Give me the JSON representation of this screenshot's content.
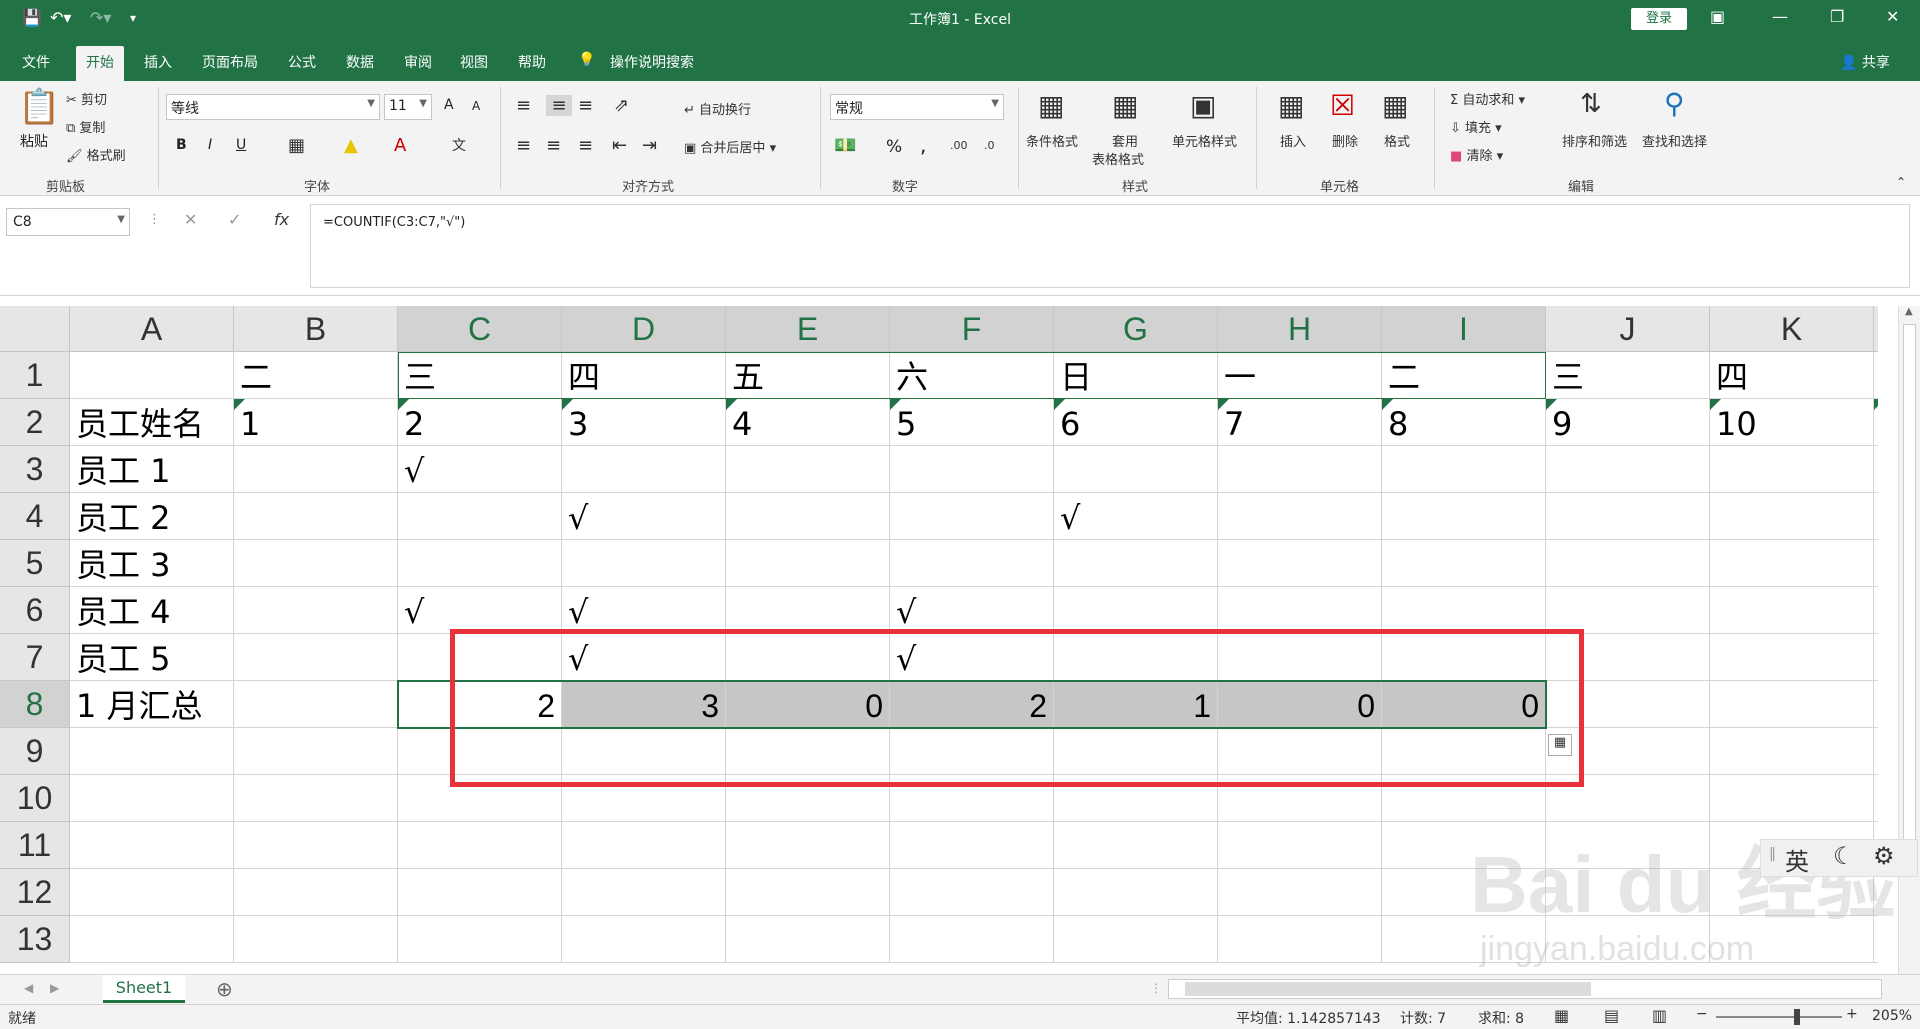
{
  "title": "工作簿1  -  Excel",
  "login": "登录",
  "share": "共享",
  "tabs": [
    "文件",
    "开始",
    "插入",
    "页面布局",
    "公式",
    "数据",
    "审阅",
    "视图",
    "帮助",
    "操作说明搜索"
  ],
  "clipboard": {
    "paste": "粘贴",
    "cut": "剪切",
    "copy": "复制",
    "painter": "格式刷",
    "group": "剪贴板"
  },
  "font": {
    "name": "等线",
    "size": "11",
    "group": "字体",
    "bold": "B",
    "italic": "I",
    "underline": "U",
    "grow": "A",
    "shrink": "A"
  },
  "align": {
    "wrap": "自动换行",
    "merge": "合并后居中",
    "group": "对齐方式"
  },
  "number": {
    "format": "常规",
    "percent": "%",
    "comma": ",",
    "group": "数字"
  },
  "styles": {
    "cond": "条件格式",
    "table1": "套用",
    "table2": "表格格式",
    "cell": "单元格样式",
    "group": "样式"
  },
  "cells": {
    "insert": "插入",
    "delete": "删除",
    "format": "格式",
    "group": "单元格"
  },
  "editing": {
    "autosum": "自动求和",
    "fill": "填充",
    "clear": "清除",
    "sort": "排序和筛选",
    "find": "查找和选择",
    "group": "编辑"
  },
  "namebox": "C8",
  "formula": "=COUNTIF(C3:C7,\"√\")",
  "columns": [
    "A",
    "B",
    "C",
    "D",
    "E",
    "F",
    "G",
    "H",
    "I",
    "J",
    "K"
  ],
  "rows": [
    "1",
    "2",
    "3",
    "4",
    "5",
    "6",
    "7",
    "8",
    "9",
    "10",
    "11",
    "12",
    "13"
  ],
  "cells_data": {
    "r1": [
      "",
      "二",
      "三",
      "四",
      "五",
      "六",
      "日",
      "一",
      "二",
      "三",
      "四"
    ],
    "r2": [
      "员工姓名",
      "1",
      "2",
      "3",
      "4",
      "5",
      "6",
      "7",
      "8",
      "9",
      "10"
    ],
    "r3": [
      "员工 1",
      "",
      "√",
      "",
      "",
      "",
      "",
      "",
      "",
      "",
      ""
    ],
    "r4": [
      "员工 2",
      "",
      "",
      "√",
      "",
      "",
      "√",
      "",
      "",
      "",
      ""
    ],
    "r5": [
      "员工 3",
      "",
      "",
      "",
      "",
      "",
      "",
      "",
      "",
      "",
      ""
    ],
    "r6": [
      "员工 4",
      "",
      "√",
      "√",
      "",
      "√",
      "",
      "",
      "",
      "",
      ""
    ],
    "r7": [
      "员工 5",
      "",
      "",
      "√",
      "",
      "√",
      "",
      "",
      "",
      "",
      ""
    ],
    "r8": [
      "1 月汇总",
      "",
      "2",
      "3",
      "0",
      "2",
      "1",
      "0",
      "0",
      "",
      ""
    ]
  },
  "sheet": "Sheet1",
  "status": {
    "ready": "就绪",
    "average": "平均值: 1.142857143",
    "count": "计数: 7",
    "sum": "求和: 8",
    "zoom": "205%"
  },
  "ime": "英",
  "watermark": "Bai du 经验",
  "watermark_url": "jingyan.baidu.com"
}
